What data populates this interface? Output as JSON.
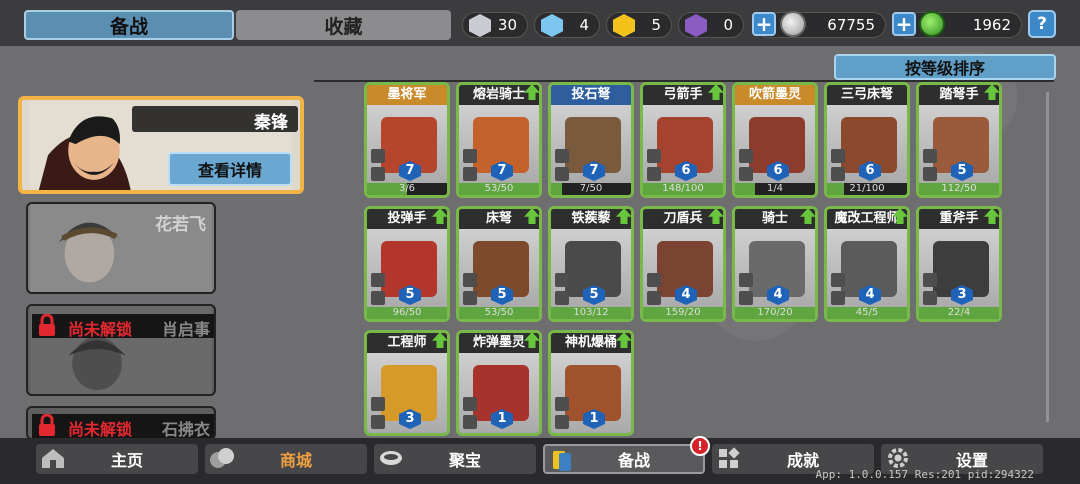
{
  "top_tabs": {
    "active": "备战",
    "inactive": "收藏"
  },
  "resources": [
    {
      "name": "silver-shard",
      "value": "30",
      "color": "#c9ccd3"
    },
    {
      "name": "blue-crystal",
      "value": "4",
      "color": "#7cc6ef"
    },
    {
      "name": "gold-badge",
      "value": "5",
      "color": "#f3c21c"
    },
    {
      "name": "purple-badge",
      "value": "0",
      "color": "#8b5cc2"
    }
  ],
  "currency": {
    "silver": "67755",
    "jade": "1962"
  },
  "help_icon": "?",
  "heroes": {
    "selected": {
      "name": "秦锋",
      "details_button": "查看详情"
    },
    "second": {
      "name": "花若飞"
    },
    "locked": [
      {
        "status": "尚未解锁",
        "name": "肖启事"
      },
      {
        "status": "尚未解锁",
        "name": "石拂衣"
      }
    ]
  },
  "sort_button": "按等级排序",
  "units": [
    {
      "name": "墨将军",
      "level": "7",
      "progress": "3/6",
      "ratio": 0.5,
      "header": "orange",
      "arrow": false
    },
    {
      "name": "熔岩骑士",
      "level": "7",
      "progress": "53/50",
      "ratio": 1,
      "header": "green",
      "arrow": true
    },
    {
      "name": "投石弩",
      "level": "7",
      "progress": "7/50",
      "ratio": 0.14,
      "header": "blue",
      "arrow": false
    },
    {
      "name": "弓箭手",
      "level": "6",
      "progress": "148/100",
      "ratio": 1,
      "header": "green",
      "arrow": true
    },
    {
      "name": "吹箭墨灵",
      "level": "6",
      "progress": "1/4",
      "ratio": 0.25,
      "header": "orange",
      "arrow": false
    },
    {
      "name": "三弓床弩",
      "level": "6",
      "progress": "21/100",
      "ratio": 0.21,
      "header": "green",
      "arrow": false
    },
    {
      "name": "踏弩手",
      "level": "5",
      "progress": "112/50",
      "ratio": 1,
      "header": "green",
      "arrow": true
    },
    {
      "name": "投弹手",
      "level": "5",
      "progress": "96/50",
      "ratio": 1,
      "header": "green",
      "arrow": true
    },
    {
      "name": "床弩",
      "level": "5",
      "progress": "53/50",
      "ratio": 1,
      "header": "green",
      "arrow": true
    },
    {
      "name": "铁蒺藜",
      "level": "5",
      "progress": "103/12",
      "ratio": 1,
      "header": "green",
      "arrow": true
    },
    {
      "name": "刀盾兵",
      "level": "4",
      "progress": "159/20",
      "ratio": 1,
      "header": "green",
      "arrow": true
    },
    {
      "name": "骑士",
      "level": "4",
      "progress": "170/20",
      "ratio": 1,
      "header": "green",
      "arrow": true
    },
    {
      "name": "魔改工程师",
      "level": "4",
      "progress": "45/5",
      "ratio": 1,
      "header": "green",
      "arrow": true
    },
    {
      "name": "重斧手",
      "level": "3",
      "progress": "22/4",
      "ratio": 1,
      "header": "green",
      "arrow": true
    },
    {
      "name": "工程师",
      "level": "3",
      "progress": "",
      "ratio": 1,
      "header": "green",
      "arrow": true
    },
    {
      "name": "炸弹墨灵",
      "level": "1",
      "progress": "",
      "ratio": 1,
      "header": "green",
      "arrow": true
    },
    {
      "name": "神机爆桶",
      "level": "1",
      "progress": "",
      "ratio": 1,
      "header": "green",
      "arrow": true
    }
  ],
  "bottom_nav": [
    {
      "label": "主页",
      "icon": "home-icon"
    },
    {
      "label": "商城",
      "icon": "coins-icon"
    },
    {
      "label": "聚宝",
      "icon": "treasure-bowl-icon"
    },
    {
      "label": "备战",
      "icon": "cards-icon"
    },
    {
      "label": "成就",
      "icon": "achievement-icon"
    },
    {
      "label": "设置",
      "icon": "gear-icon"
    }
  ],
  "notification_badge": "!",
  "version_text": "App: 1.0.0.157 Res:201 pid:294322"
}
